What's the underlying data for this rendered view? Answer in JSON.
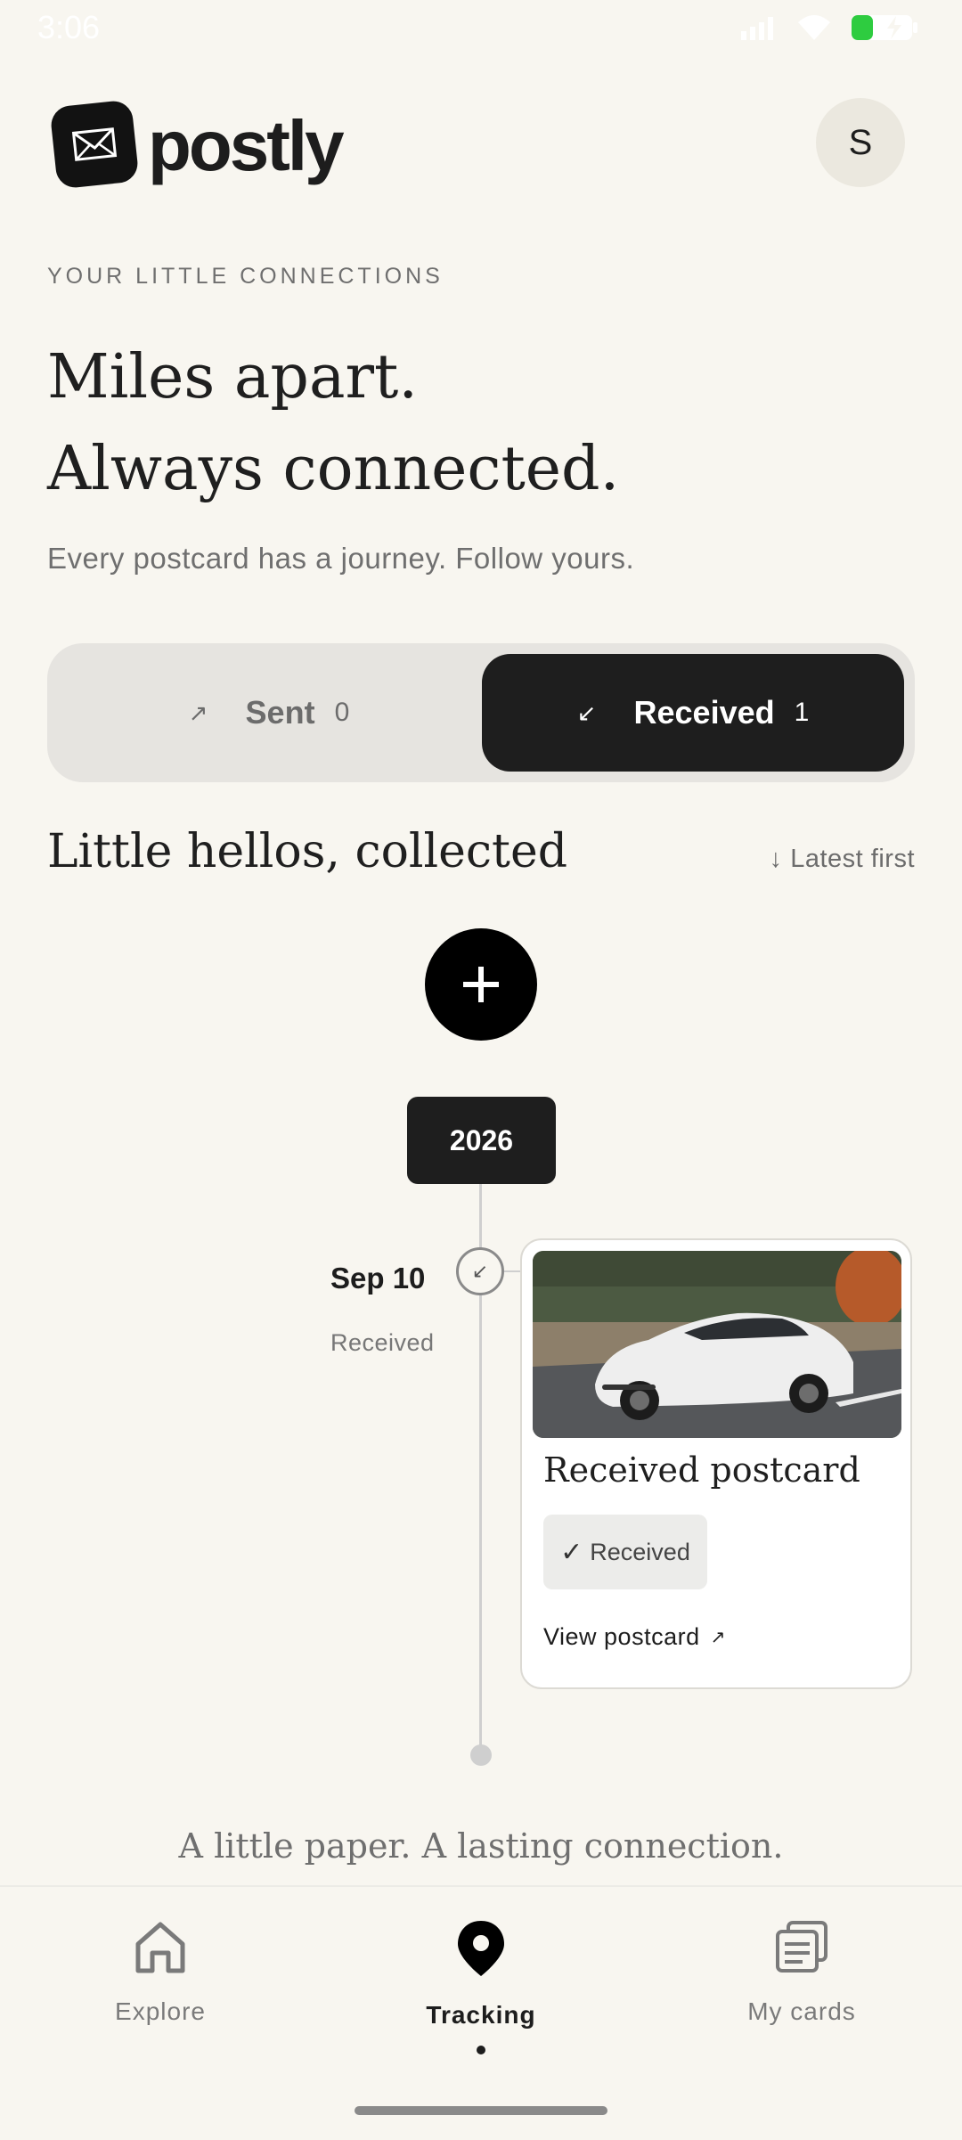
{
  "status_bar": {
    "time": "3:06"
  },
  "brand": {
    "name": "postly"
  },
  "profile": {
    "initial": "S"
  },
  "hero": {
    "eyebrow": "YOUR LITTLE CONNECTIONS",
    "headline_line1": "Miles apart.",
    "headline_line2": "Always connected.",
    "subline": "Every postcard has a journey. Follow yours."
  },
  "tabs": [
    {
      "label": "Sent",
      "count": "0",
      "arrow": "↗",
      "selected": false
    },
    {
      "label": "Received",
      "count": "1",
      "arrow": "↙",
      "selected": true
    }
  ],
  "section": {
    "title": "Little hellos, collected",
    "sort_label": "↓ Latest first"
  },
  "timeline": {
    "year": "2026",
    "entries": [
      {
        "date": "Sep 10",
        "status": "Received",
        "card_title": "Received postcard",
        "chip_label": "Received",
        "link_label": "View postcard",
        "link_arrow": "↗"
      }
    ]
  },
  "footer": {
    "tagline": "A little paper. A lasting connection."
  },
  "bottom_nav": [
    {
      "label": "Explore",
      "icon": "home-icon",
      "active": false
    },
    {
      "label": "Tracking",
      "icon": "location-pin-icon",
      "active": true
    },
    {
      "label": "My cards",
      "icon": "cards-stack-icon",
      "active": false
    }
  ],
  "colors": {
    "background": "#f8f6f0",
    "ink": "#1e1e1e",
    "battery": "#2ecc40"
  }
}
